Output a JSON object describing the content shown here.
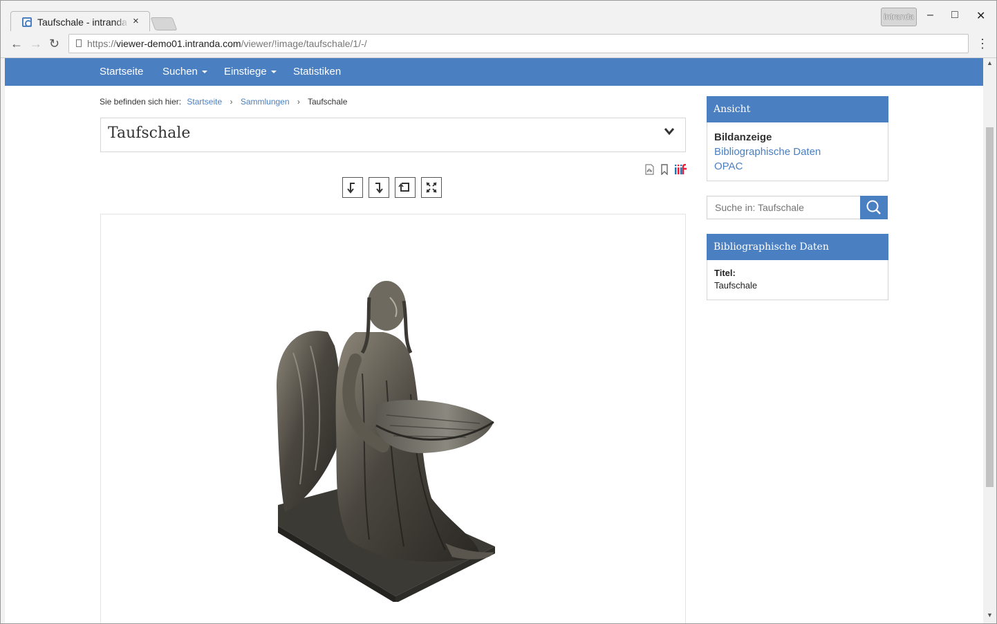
{
  "browser": {
    "tab_title": "Taufschale - intranda",
    "tab_close": "×",
    "profile_name": "intranda",
    "url_scheme": "https://",
    "url_host": "viewer-demo01.intranda.com",
    "url_path": "/viewer/!image/taufschale/1/-/",
    "window_controls": {
      "minimize": "–",
      "maximize": "□",
      "close": "✕"
    },
    "nav_icons": {
      "back": "←",
      "forward": "→",
      "reload": "↻",
      "menu": "⋮"
    }
  },
  "navbar": {
    "items": [
      {
        "label": "Startseite",
        "dropdown": false
      },
      {
        "label": "Suchen",
        "dropdown": true
      },
      {
        "label": "Einstiege",
        "dropdown": true
      },
      {
        "label": "Statistiken",
        "dropdown": false
      }
    ]
  },
  "breadcrumb": {
    "prefix": "Sie befinden sich hier:",
    "items": [
      "Startseite",
      "Sammlungen",
      "Taufschale"
    ],
    "separator": "›"
  },
  "record": {
    "title": "Taufschale"
  },
  "doc_icons": [
    "pdf-icon",
    "bookmark-icon",
    "iiif-icon"
  ],
  "image_controls": [
    "rotate-left-icon",
    "rotate-right-icon",
    "reset-view-icon",
    "fullscreen-icon"
  ],
  "sidebar": {
    "view_widget": {
      "heading": "Ansicht",
      "items": [
        {
          "label": "Bildanzeige",
          "active": true
        },
        {
          "label": "Bibliographische Daten",
          "active": false
        },
        {
          "label": "OPAC",
          "active": false
        }
      ]
    },
    "search": {
      "placeholder": "Suche in: Taufschale"
    },
    "biblio_widget": {
      "heading": "Bibliographische Daten",
      "field_label": "Titel:",
      "field_value": "Taufschale"
    }
  },
  "colors": {
    "accent": "#4a7fc1",
    "link": "#4a7fc1",
    "text": "#333333"
  }
}
